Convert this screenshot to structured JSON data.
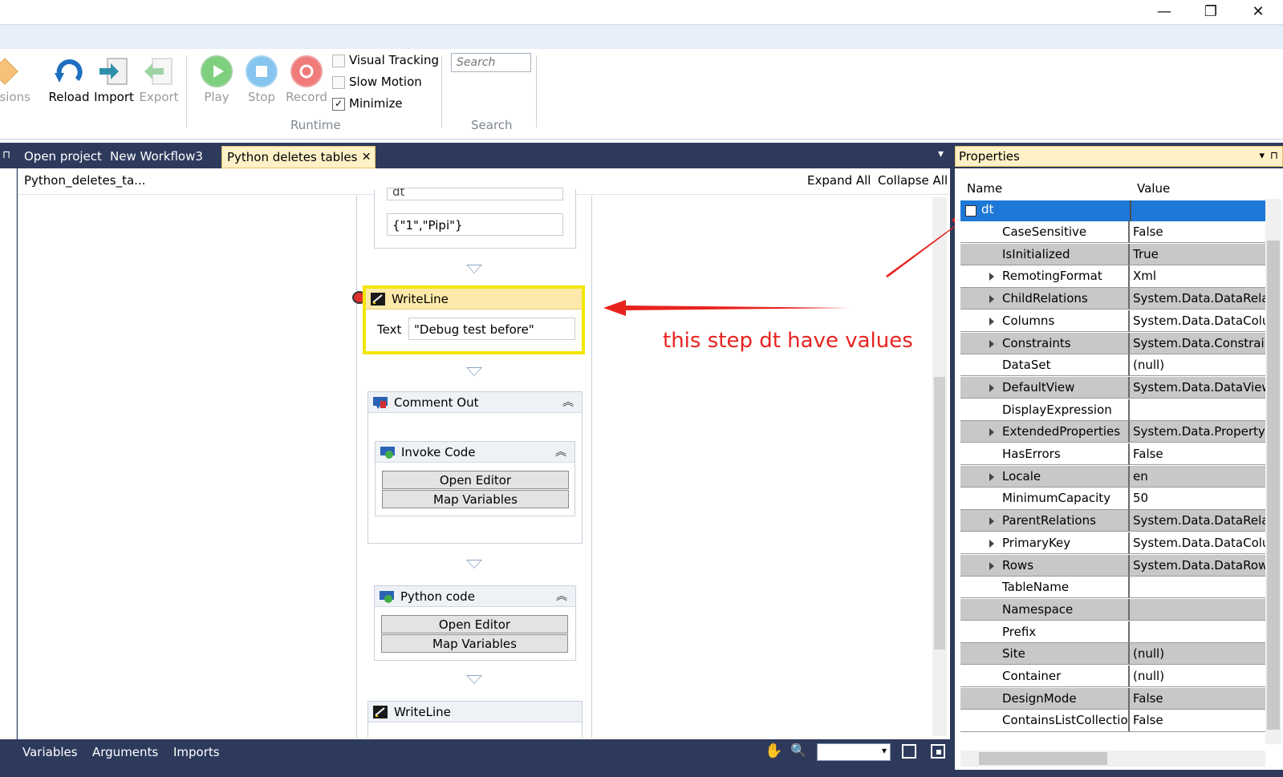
{
  "window": {
    "minimize_glyph": "—",
    "restore_glyph": "❐",
    "close_glyph": "✕"
  },
  "ribbon": {
    "permissions_label": "nissions",
    "reload_label": "Reload",
    "import_label": "Import",
    "export_label": "Export",
    "play_label": "Play",
    "stop_label": "Stop",
    "record_label": "Record",
    "visual_tracking_label": "Visual Tracking",
    "slow_motion_label": "Slow Motion",
    "minimize_label": "Minimize",
    "minimize_checked": "✓",
    "runtime_group": "Runtime",
    "search_placeholder": "Search",
    "search_group": "Search"
  },
  "tabs": {
    "open_project": "Open project",
    "new_workflow": "New Workflow3",
    "active": "Python deletes tables",
    "close_glyph": "✕"
  },
  "designer": {
    "breadcrumb": "Python_deletes_ta...",
    "expand_all": "Expand All",
    "collapse_all": "Collapse All",
    "top_field_partial": "dt",
    "top_field_value": "{\"1\",\"Pipi\"}",
    "writeline1": {
      "title": "WriteLine",
      "text_label": "Text",
      "text_value": "\"Debug test before\""
    },
    "comment_out": {
      "title": "Comment Out",
      "collapse": "︽"
    },
    "invoke_code": {
      "title": "Invoke Code",
      "open_editor": "Open Editor",
      "map_variables": "Map Variables",
      "collapse": "︽"
    },
    "python_code": {
      "title": "Python code",
      "open_editor": "Open Editor",
      "map_variables": "Map Variables",
      "collapse": "︽"
    },
    "writeline2": {
      "title": "WriteLine"
    }
  },
  "bottom_bar": {
    "variables": "Variables",
    "arguments": "Arguments",
    "imports": "Imports",
    "hand_icon_glyph": "✋",
    "zoom_icon_glyph": "🔍"
  },
  "properties": {
    "title": "Properties",
    "col_name": "Name",
    "col_value": "Value",
    "root": "dt",
    "rows": [
      {
        "name": "CaseSensitive",
        "value": "False",
        "expandable": false
      },
      {
        "name": "IsInitialized",
        "value": "True",
        "expandable": false
      },
      {
        "name": "RemotingFormat",
        "value": "Xml",
        "expandable": true
      },
      {
        "name": "ChildRelations",
        "value": "System.Data.DataRela",
        "expandable": true
      },
      {
        "name": "Columns",
        "value": "System.Data.DataColu",
        "expandable": true
      },
      {
        "name": "Constraints",
        "value": "System.Data.Constrair",
        "expandable": true
      },
      {
        "name": "DataSet",
        "value": "(null)",
        "expandable": false
      },
      {
        "name": "DefaultView",
        "value": "System.Data.DataView",
        "expandable": true
      },
      {
        "name": "DisplayExpression",
        "value": "",
        "expandable": false
      },
      {
        "name": "ExtendedProperties",
        "value": "System.Data.Property(",
        "expandable": true
      },
      {
        "name": "HasErrors",
        "value": "False",
        "expandable": false
      },
      {
        "name": "Locale",
        "value": "en",
        "expandable": true
      },
      {
        "name": "MinimumCapacity",
        "value": "50",
        "expandable": false
      },
      {
        "name": "ParentRelations",
        "value": "System.Data.DataRela",
        "expandable": true
      },
      {
        "name": "PrimaryKey",
        "value": "System.Data.DataColu",
        "expandable": true
      },
      {
        "name": "Rows",
        "value": "System.Data.DataRow",
        "expandable": true
      },
      {
        "name": "TableName",
        "value": "",
        "expandable": false
      },
      {
        "name": "Namespace",
        "value": "",
        "expandable": false
      },
      {
        "name": "Prefix",
        "value": "",
        "expandable": false
      },
      {
        "name": "Site",
        "value": "(null)",
        "expandable": false
      },
      {
        "name": "Container",
        "value": "(null)",
        "expandable": false
      },
      {
        "name": "DesignMode",
        "value": "False",
        "expandable": false
      },
      {
        "name": "ContainsListCollection",
        "value": "False",
        "expandable": false
      }
    ]
  },
  "annotation": {
    "text": "this step dt have values",
    "color": "#e8231f"
  },
  "colors": {
    "frame": "#2d3a5c",
    "highlight": "#f2e600",
    "selected_row": "#1e78d7",
    "tab_active": "#fff1c7"
  }
}
